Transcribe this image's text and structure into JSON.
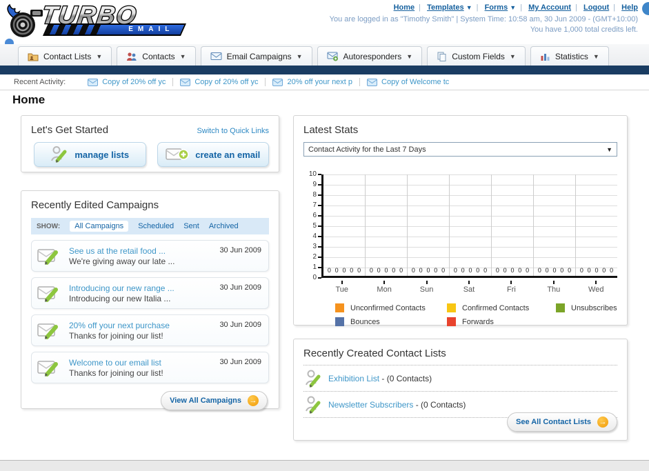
{
  "brand": {
    "turbo": "TURBO",
    "email": "EMAIL"
  },
  "topnav": {
    "links": [
      {
        "label": "Home",
        "caret": false
      },
      {
        "label": "Templates",
        "caret": true
      },
      {
        "label": "Forms",
        "caret": true
      },
      {
        "label": "My Account",
        "caret": false
      },
      {
        "label": "Logout",
        "caret": false
      },
      {
        "label": "Help",
        "caret": false
      }
    ]
  },
  "session": {
    "line1": "You are logged in as \"Timothy Smith\" | System Time: 10:58 am, 30 Jun 2009 - (GMT+10:00)",
    "line2": "You have 1,000 total credits left."
  },
  "tabs": [
    {
      "label": "Contact Lists",
      "icon": "contact-lists-folder-icon"
    },
    {
      "label": "Contacts",
      "icon": "contacts-people-icon"
    },
    {
      "label": "Email Campaigns",
      "icon": "email-envelope-icon"
    },
    {
      "label": "Autoresponders",
      "icon": "autoresponder-envelope-icon"
    },
    {
      "label": "Custom Fields",
      "icon": "custom-fields-pages-icon"
    },
    {
      "label": "Statistics",
      "icon": "statistics-bars-icon"
    }
  ],
  "activity": {
    "label": "Recent Activity:",
    "items": [
      "Copy of 20% off yc",
      "Copy of 20% off yc",
      "20% off your next p",
      "Copy of Welcome tc"
    ]
  },
  "page": {
    "title": "Home"
  },
  "get_started": {
    "title": "Let's Get Started",
    "switch_link": "Switch to Quick Links",
    "buttons": [
      {
        "label": "manage lists"
      },
      {
        "label": "create an email"
      }
    ]
  },
  "campaigns": {
    "title": "Recently Edited Campaigns",
    "show_label": "SHOW:",
    "filters": [
      "All Campaigns",
      "Scheduled",
      "Sent",
      "Archived"
    ],
    "selected_filter": "All Campaigns",
    "items": [
      {
        "title": "See us at the retail food ...",
        "subtitle": "We're giving away our late ...",
        "date": "30 Jun 2009"
      },
      {
        "title": "Introducing our new range ...",
        "subtitle": "Introducing our new Italia ...",
        "date": "30 Jun 2009"
      },
      {
        "title": "20% off your next purchase",
        "subtitle": "Thanks for joining our list!",
        "date": "30 Jun 2009"
      },
      {
        "title": "Welcome to our email list",
        "subtitle": "Thanks for joining our list!",
        "date": "30 Jun 2009"
      }
    ],
    "view_all": "View All Campaigns"
  },
  "stats": {
    "title": "Latest Stats",
    "dropdown_value": "Contact Activity for the Last 7 Days"
  },
  "chart_data": {
    "type": "bar",
    "title": "Contact Activity for the Last 7 Days",
    "categories": [
      "Tue",
      "Mon",
      "Sun",
      "Sat",
      "Fri",
      "Thu",
      "Wed"
    ],
    "series": [
      {
        "name": "Unconfirmed Contacts",
        "color": "#f5921e",
        "values": [
          0,
          0,
          0,
          0,
          0,
          0,
          0
        ]
      },
      {
        "name": "Confirmed Contacts",
        "color": "#f8c613",
        "values": [
          0,
          0,
          0,
          0,
          0,
          0,
          0
        ]
      },
      {
        "name": "Unsubscribes",
        "color": "#7ba428",
        "values": [
          0,
          0,
          0,
          0,
          0,
          0,
          0
        ]
      },
      {
        "name": "Bounces",
        "color": "#5572a7",
        "values": [
          0,
          0,
          0,
          0,
          0,
          0,
          0
        ]
      },
      {
        "name": "Forwards",
        "color": "#e8432d",
        "values": [
          0,
          0,
          0,
          0,
          0,
          0,
          0
        ]
      }
    ],
    "ylim": [
      0,
      10
    ],
    "yticks": [
      0,
      1,
      2,
      3,
      4,
      5,
      6,
      7,
      8,
      9,
      10
    ],
    "grid": true,
    "data_labels": "each bar shows 0",
    "legend_position": "bottom"
  },
  "contact_lists": {
    "title": "Recently Created Contact Lists",
    "items": [
      {
        "name": "Exhibition List",
        "count": "- (0 Contacts)"
      },
      {
        "name": "Newsletter Subscribers",
        "count": "- (0 Contacts)"
      }
    ],
    "see_all": "See All Contact Lists"
  }
}
